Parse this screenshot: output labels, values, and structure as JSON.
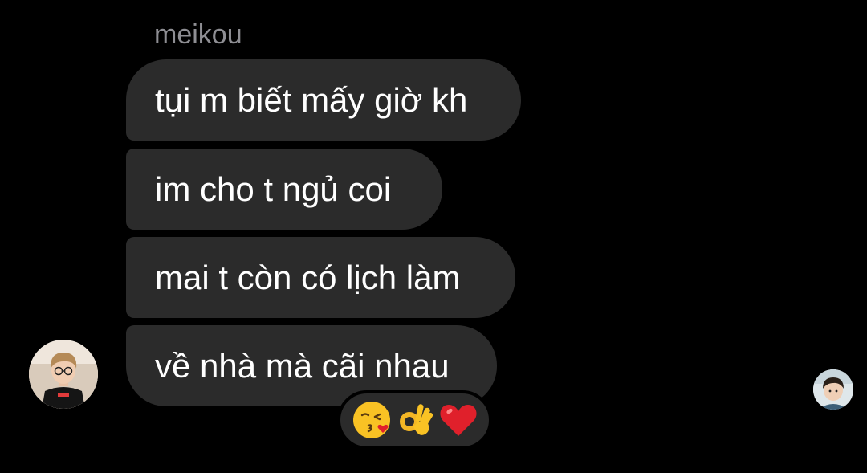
{
  "conversation": {
    "sender_name": "meikou",
    "messages": [
      {
        "text": "tụi m biết mấy giờ kh"
      },
      {
        "text": "im cho t ngủ coi"
      },
      {
        "text": "mai t còn có lịch làm"
      },
      {
        "text": "về nhà mà cãi nhau"
      }
    ],
    "reactions": [
      {
        "icon": "kissing-face-with-heart-icon"
      },
      {
        "icon": "ok-hand-icon"
      },
      {
        "icon": "red-heart-icon"
      }
    ]
  },
  "colors": {
    "background": "#000000",
    "bubble": "#2b2b2b",
    "message_text": "#ffffff",
    "sender_text": "#8e8e93",
    "heart": "#e0202b",
    "emoji_yellow": "#f9c224"
  }
}
